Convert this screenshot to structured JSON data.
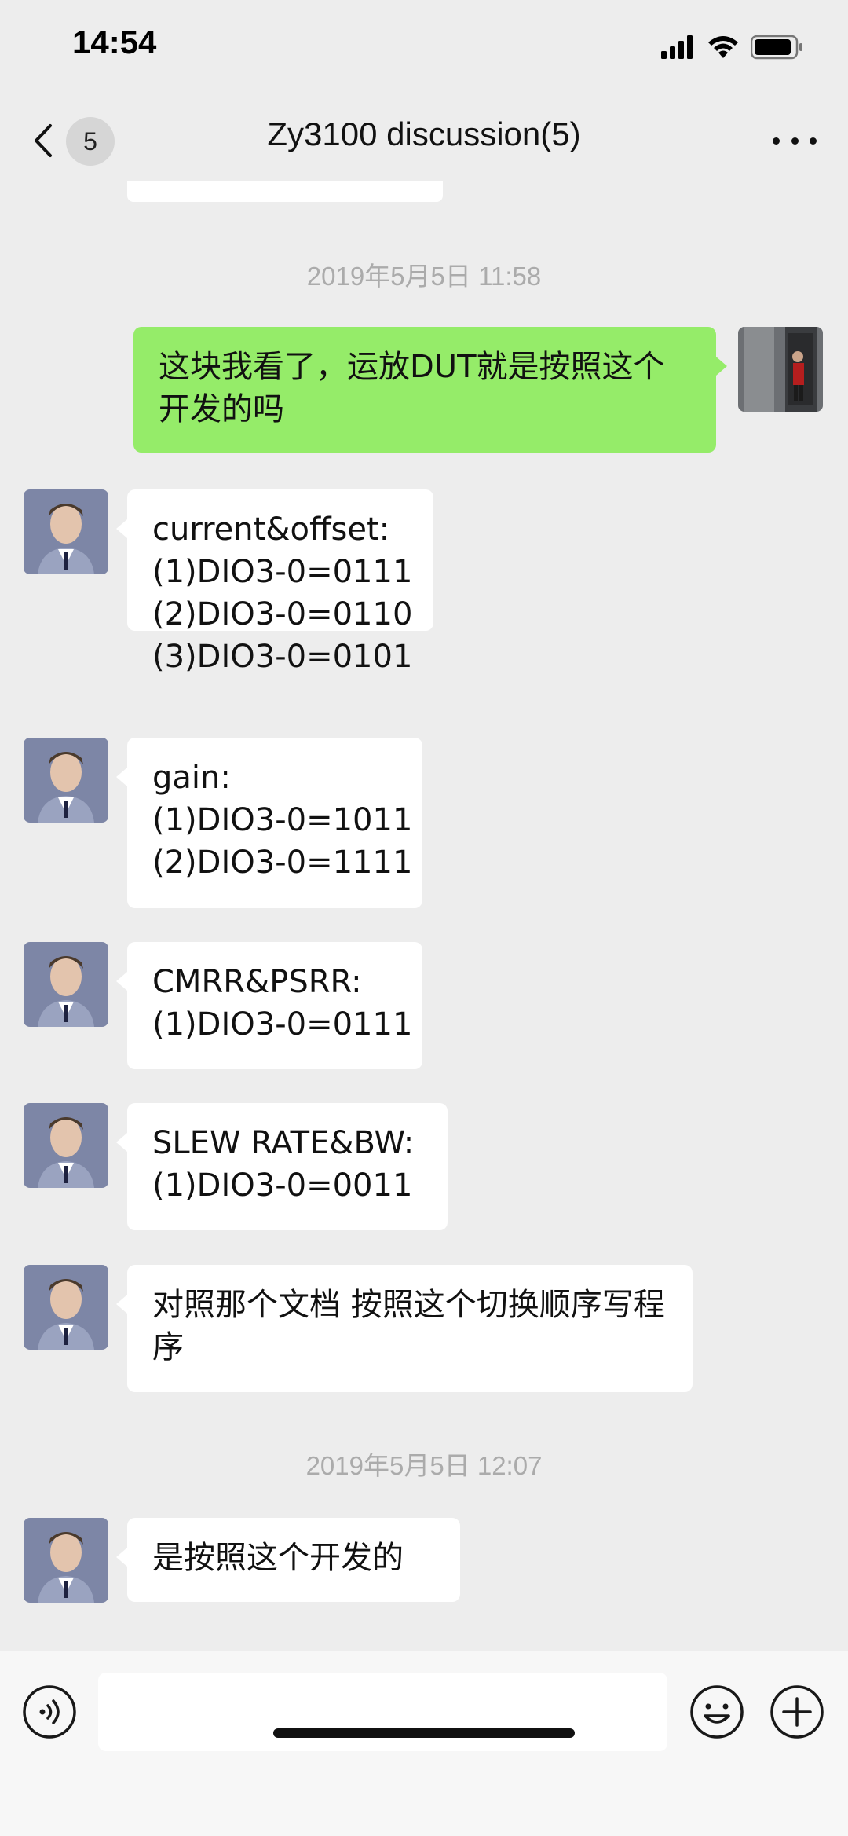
{
  "status_bar": {
    "time": "14:54"
  },
  "nav": {
    "unread_count": "5",
    "title": "Zy3100 discussion(5)"
  },
  "messages": {
    "ts1": "2019年5月5日 11:58",
    "m1": [
      "这块我看了，运放DUT就是按照这个开发的吗"
    ],
    "m2": [
      "current&offset:",
      "(1)DIO3-0=0111",
      "(2)DIO3-0=0110",
      "(3)DIO3-0=0101"
    ],
    "m3": [
      "gain:",
      "(1)DIO3-0=1011",
      "(2)DIO3-0=1111"
    ],
    "m4": [
      "CMRR&PSRR:",
      "(1)DIO3-0=0111"
    ],
    "m5": [
      "SLEW RATE&BW:",
      "(1)DIO3-0=0011"
    ],
    "m6": [
      "对照那个文档  按照这个切换顺序写程序"
    ],
    "ts2": "2019年5月5日 12:07",
    "m7": [
      "是按照这个开发的"
    ]
  },
  "input": {
    "value": ""
  },
  "colors": {
    "background": "#ededed",
    "outgoing_bubble": "#95ec69",
    "incoming_bubble": "#ffffff",
    "timestamp_text": "#ababab"
  },
  "icons": {
    "back": "chevron-left-icon",
    "more": "more-dots-icon",
    "voice": "voice-icon",
    "emoji": "emoji-icon",
    "plus": "plus-icon"
  }
}
